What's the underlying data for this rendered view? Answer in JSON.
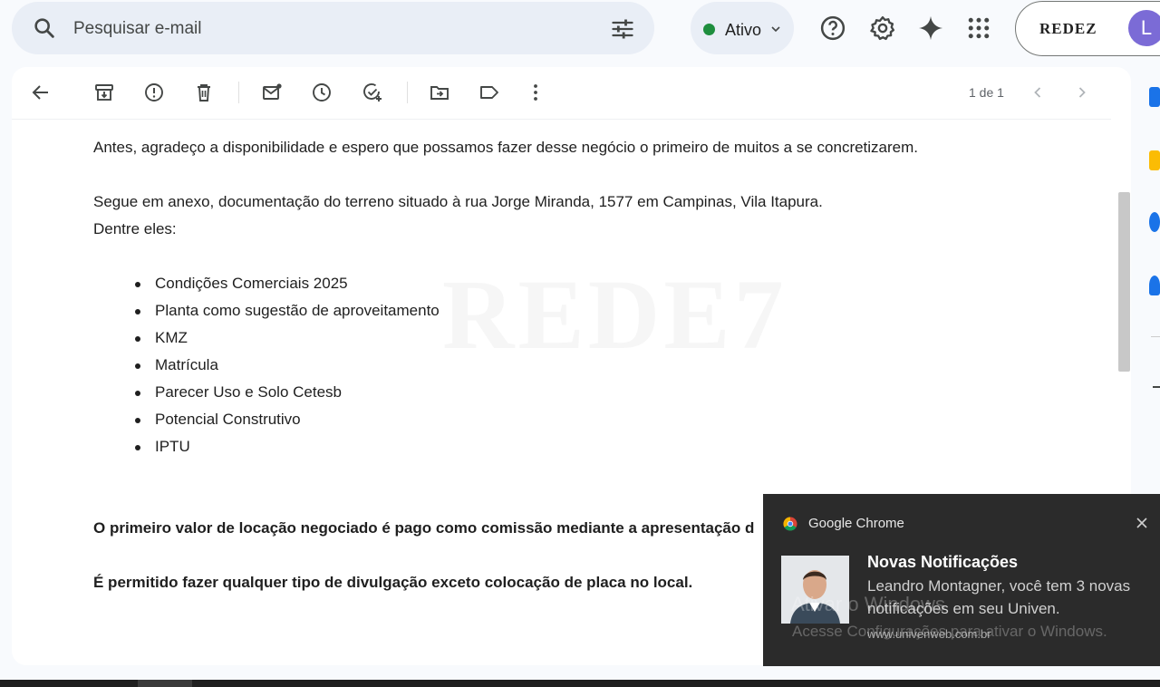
{
  "search": {
    "placeholder": "Pesquisar e-mail"
  },
  "status": {
    "label": "Ativo",
    "color": "#1e8e3e"
  },
  "account": {
    "brand": "REDEZ",
    "avatar_letter": "L",
    "avatar_color": "#7b6bd6"
  },
  "toolbar": {
    "pager": "1 de 1"
  },
  "email": {
    "para1": "Antes, agradeço a disponibilidade e espero que possamos fazer desse negócio o primeiro de muitos a se concretizarem.",
    "para2": "Segue em anexo, documentação do terreno situado à rua Jorge Miranda, 1577 em Campinas, Vila Itapura.",
    "para3": "Dentre eles:",
    "items": [
      "Condições Comerciais 2025",
      "Planta como sugestão de aproveitamento",
      "KMZ",
      "Matrícula",
      "Parecer Uso e Solo Cetesb",
      "Potencial Construtivo",
      "IPTU"
    ],
    "bold1": "O primeiro valor de locação negociado é pago como comissão mediante a apresentação d",
    "bold2": "É permitido fazer qualquer tipo de divulgação exceto colocação de placa no local.",
    "watermark": "REDE7"
  },
  "notification": {
    "app": "Google Chrome",
    "title": "Novas Notificações",
    "message": "Leandro Montagner, você tem 3 novas notificações em seu Univen.",
    "url": "www.univenweb.com.br"
  },
  "windows_overlay": {
    "line1": "Ativar o Windows",
    "line2": "Acesse Configurações para ativar o Windows."
  }
}
